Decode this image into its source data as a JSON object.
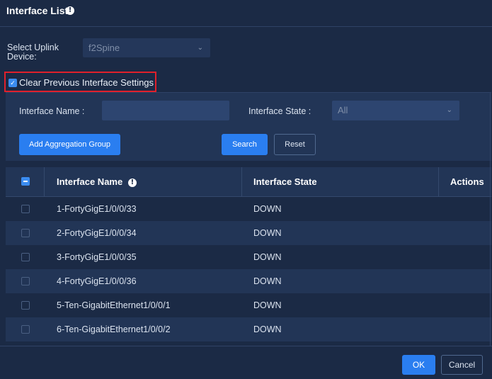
{
  "dialog": {
    "title": "Interface List",
    "info_icon": "info-icon"
  },
  "uplink": {
    "label": "Select Uplink Device:",
    "value": "f2Spine"
  },
  "clear_previous": {
    "label": "Clear Previous Interface Settings",
    "checked": true
  },
  "filters": {
    "name_label": "Interface Name :",
    "name_value": "",
    "state_label": "Interface State :",
    "state_value": "All"
  },
  "buttons": {
    "add_aggregation": "Add Aggregation Group",
    "search": "Search",
    "reset": "Reset",
    "ok": "OK",
    "cancel": "Cancel"
  },
  "table": {
    "columns": {
      "name": "Interface Name",
      "state": "Interface State",
      "actions": "Actions"
    },
    "rows": [
      {
        "name": "1-FortyGigE1/0/0/33",
        "state": "DOWN"
      },
      {
        "name": "2-FortyGigE1/0/0/34",
        "state": "DOWN"
      },
      {
        "name": "3-FortyGigE1/0/0/35",
        "state": "DOWN"
      },
      {
        "name": "4-FortyGigE1/0/0/36",
        "state": "DOWN"
      },
      {
        "name": "5-Ten-GigabitEthernet1/0/0/1",
        "state": "DOWN"
      },
      {
        "name": "6-Ten-GigabitEthernet1/0/0/2",
        "state": "DOWN"
      }
    ]
  },
  "colors": {
    "background": "#1b2a45",
    "panel": "#223556",
    "accent": "#2a7ef0",
    "highlight_border": "#e0202b"
  }
}
